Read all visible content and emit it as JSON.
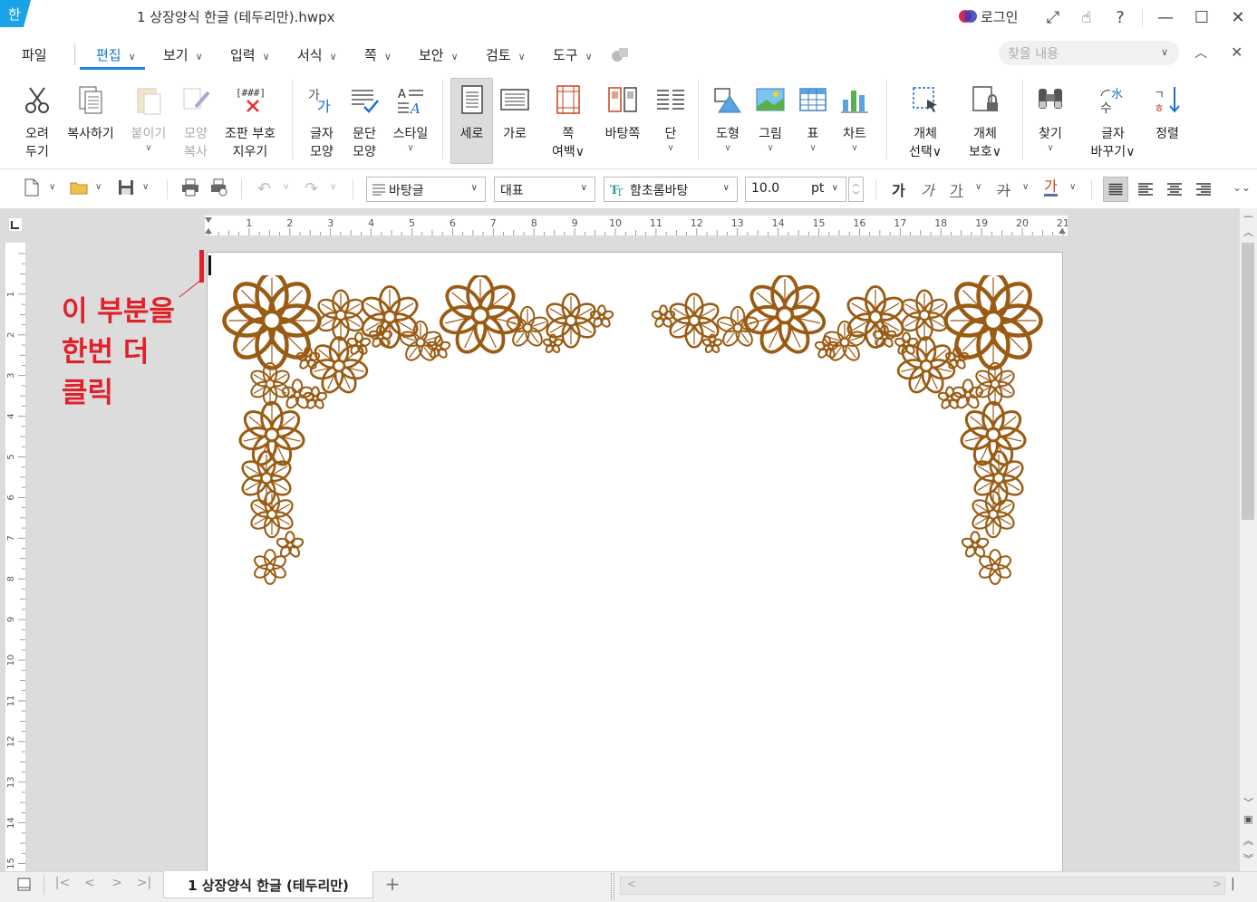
{
  "window": {
    "title": "1 상장양식 한글 (테두리만).hwpx",
    "login_label": "로그인",
    "app_logo_letter": "한",
    "controls": [
      "expand-icon",
      "touch-icon",
      "help-icon",
      "minimize-icon",
      "maximize-icon",
      "close-icon"
    ]
  },
  "menu": {
    "file": "파일",
    "edit": "편집",
    "view": "보기",
    "input": "입력",
    "format": "서식",
    "page": "쪽",
    "security": "보안",
    "review": "검토",
    "tools": "도구",
    "search_placeholder": "찾을 내용"
  },
  "ribbon": {
    "cut": [
      "오려",
      "두기"
    ],
    "copy": "복사하기",
    "paste": "붙이기",
    "format_copy": [
      "모양",
      "복사"
    ],
    "clear_layout": [
      "조판 부호",
      "지우기"
    ],
    "char_shape": [
      "글자",
      "모양"
    ],
    "para_shape": [
      "문단",
      "모양"
    ],
    "style": "스타일",
    "portrait": "세로",
    "landscape": "가로",
    "page_margin": [
      "쪽",
      "여백"
    ],
    "master_page": "바탕쪽",
    "columns": "단",
    "shape": "도형",
    "picture": "그림",
    "table": "표",
    "chart": "차트",
    "select_object": [
      "개체",
      "선택"
    ],
    "protect_object": [
      "개체",
      "보호"
    ],
    "find": "찾기",
    "change_char": [
      "글자",
      "바꾸기"
    ],
    "sort": "정렬"
  },
  "toolbar": {
    "style_value": "바탕글",
    "lang_value": "대표",
    "font_value": "함초롬바탕",
    "size_value": "10.0",
    "size_unit": "pt",
    "bold_glyph": "가",
    "italic_glyph": "가",
    "underline_glyph": "가",
    "strike_glyph": "가",
    "color_glyph": "가"
  },
  "ruler": {
    "h_ticks": [
      "1",
      "2",
      "3",
      "4",
      "5",
      "6",
      "7",
      "8",
      "9",
      "10",
      "11",
      "12",
      "13",
      "14",
      "15",
      "16",
      "17",
      "18",
      "19",
      "20",
      "21"
    ],
    "v_ticks": [
      "1",
      "2",
      "3",
      "4",
      "5",
      "6",
      "7",
      "8",
      "9",
      "10",
      "11",
      "12",
      "13",
      "14",
      "15"
    ]
  },
  "annotation": {
    "lines": [
      "이 부분을",
      "한번 더",
      "클릭"
    ],
    "color": "#e2202a"
  },
  "ornament_color": "#9a5c14",
  "status": {
    "sheet_tab": "1 상장양식 한글 (테두리만)",
    "add_tab": "+"
  }
}
